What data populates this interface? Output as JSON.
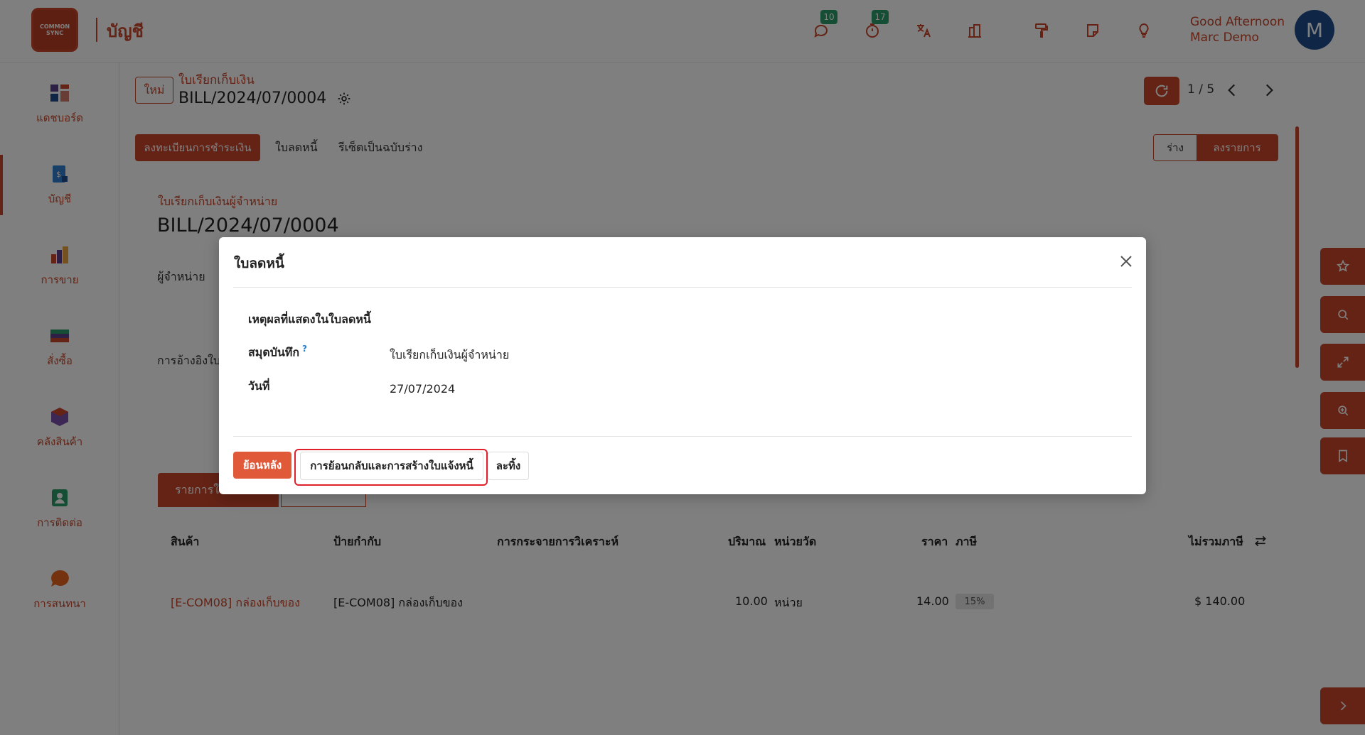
{
  "header": {
    "logo_text": "COMMON SYNC",
    "app_title": "บัญชี",
    "messages_badge": "10",
    "activities_badge": "17",
    "greeting_line1": "Good Afternoon",
    "greeting_line2": "Marc Demo",
    "avatar_initial": "M",
    "icons": [
      "chat-icon",
      "timer-icon",
      "translate-icon",
      "company-icon",
      "paint-roller-icon",
      "note-icon",
      "lightbulb-icon"
    ]
  },
  "sidebar": {
    "items": [
      {
        "label": "แดชบอร์ด",
        "icon": "dashboard-icon"
      },
      {
        "label": "บัญชี",
        "icon": "accounting-icon"
      },
      {
        "label": "การขาย",
        "icon": "sales-icon"
      },
      {
        "label": "สั่งซื้อ",
        "icon": "purchase-icon"
      },
      {
        "label": "คลังสินค้า",
        "icon": "inventory-icon"
      },
      {
        "label": "การติดต่อ",
        "icon": "contacts-icon"
      },
      {
        "label": "การสนทนา",
        "icon": "discuss-icon"
      }
    ]
  },
  "record": {
    "new_label": "ใหม่",
    "breadcrumb": "ใบเรียกเก็บเงิน",
    "name": "BILL/2024/07/0004",
    "pager": "1 / 5"
  },
  "actions": {
    "register_payment": "ลงทะเบียนการชำระเงิน",
    "credit_note": "ใบลดหนี้",
    "reset_draft": "รีเซ็ตเป็นฉบับร่าง",
    "status_draft": "ร่าง",
    "status_posted": "ลงรายการ"
  },
  "form": {
    "subtitle": "ใบเรียกเก็บเงินผู้จำหน่าย",
    "title": "BILL/2024/07/0004",
    "vendor_label": "ผู้จำหน่าย",
    "reference_label": "การอ้างอิงใบ",
    "tab_lines": "รายการใ"
  },
  "table": {
    "headers": [
      "สินค้า",
      "ป้ายกำกับ",
      "การกระจายการวิเคราะห์",
      "ปริมาณ",
      "หน่วยวัด",
      "ราคา",
      "ภาษี",
      "ไม่รวมภาษี"
    ],
    "row": {
      "product": "[E-COM08] กล่องเก็บของ",
      "label": "[E-COM08] กล่องเก็บของ",
      "quantity": "10.00",
      "uom": "หน่วย",
      "price": "14.00",
      "tax": "15%",
      "subtotal": "$ 140.00"
    }
  },
  "modal": {
    "title": "ใบลดหนี้",
    "reason_label": "เหตุผลที่แสดงในใบลดหนี้",
    "journal_label": "สมุดบันทึก",
    "journal_help": "?",
    "journal_value": "ใบเรียกเก็บเงินผู้จำหน่าย",
    "date_label": "วันที่",
    "date_value": "27/07/2024",
    "btn_reverse": "ย้อนหลัง",
    "btn_reverse_new": "การย้อนกลับและการสร้างใบแจ้งหนี้",
    "btn_discard": "ละทิ้ง"
  },
  "colors": {
    "brand": "#c8462a",
    "badge": "#2c9a6a",
    "avatar": "#1e4d8c",
    "highlight": "#e0202a"
  }
}
